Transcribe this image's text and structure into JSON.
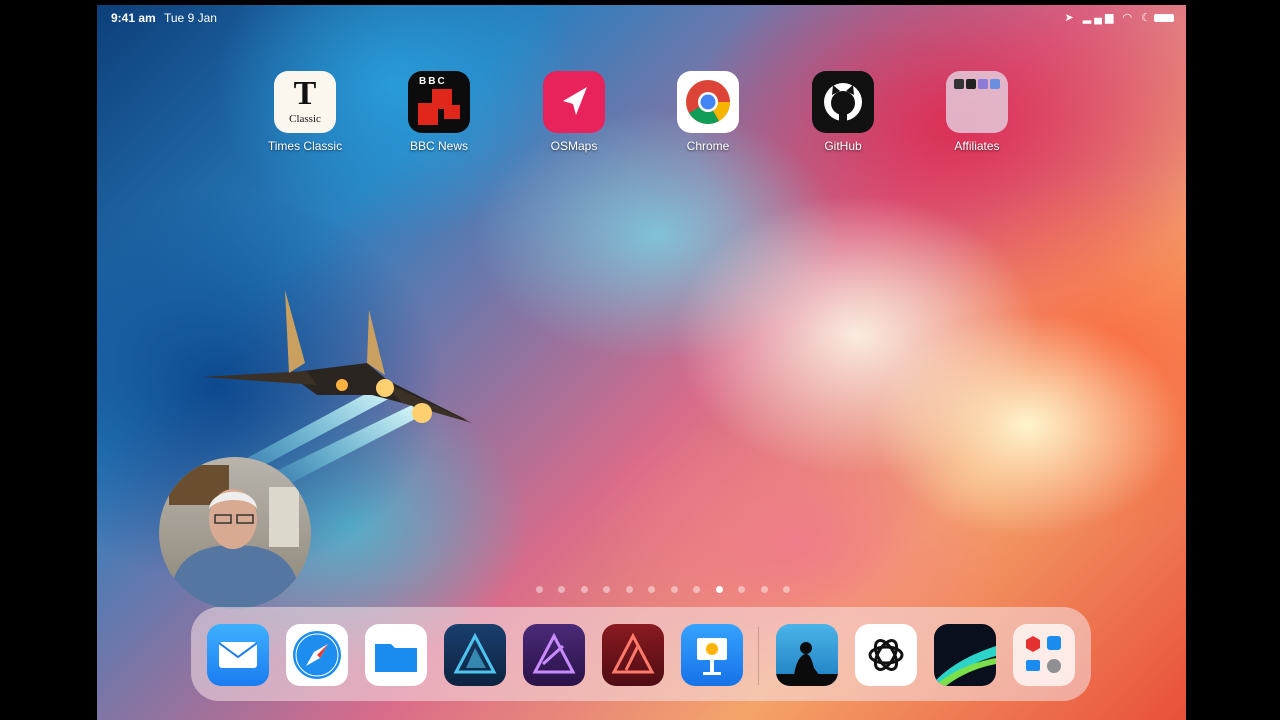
{
  "status_bar": {
    "time": "9:41 am",
    "date": "Tue 9 Jan"
  },
  "home_apps": [
    {
      "label": "Times Classic",
      "tile_text": "T",
      "tile_subtext": "Classic"
    },
    {
      "label": "BBC News",
      "tile_text": "BBC"
    },
    {
      "label": "OSMaps"
    },
    {
      "label": "Chrome"
    },
    {
      "label": "GitHub"
    },
    {
      "label": "Affiliates"
    }
  ],
  "page_indicator": {
    "total": 12,
    "current": 9
  },
  "dock_apps": [
    {
      "name": "Mail",
      "icon": "envelope-icon"
    },
    {
      "name": "Safari",
      "icon": "compass-icon"
    },
    {
      "name": "Files",
      "icon": "folder-icon"
    },
    {
      "name": "Affinity Designer",
      "icon": "affinity-designer-icon"
    },
    {
      "name": "Affinity Photo",
      "icon": "affinity-photo-icon"
    },
    {
      "name": "Affinity Publisher",
      "icon": "affinity-publisher-icon"
    },
    {
      "name": "Keynote",
      "icon": "keynote-icon"
    },
    {
      "name": "Kindle",
      "icon": "kindle-reader-icon"
    },
    {
      "name": "ChatGPT",
      "icon": "chatgpt-icon"
    },
    {
      "name": "LumaFusion",
      "icon": "lumafusion-icon"
    },
    {
      "name": "App Library",
      "icon": "app-library-icon"
    }
  ],
  "colors": {
    "dock": "#f5e1e6",
    "os_maps": "#e8235c",
    "bbc_red": "#e1261c"
  }
}
